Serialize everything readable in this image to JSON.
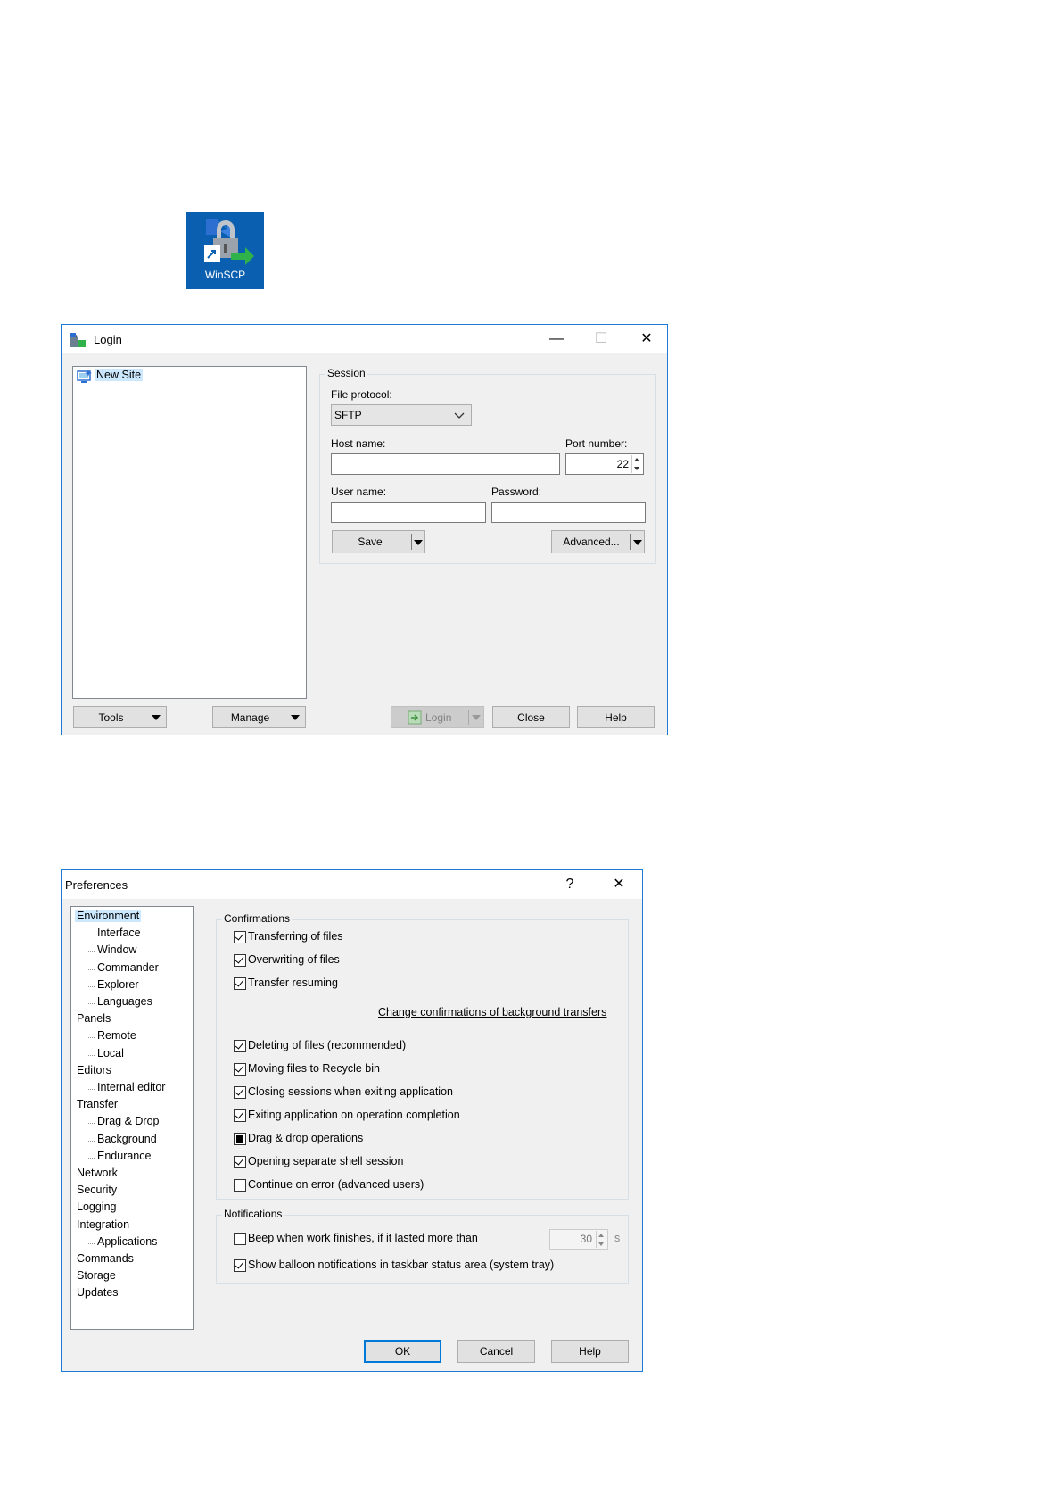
{
  "desktop_icon": {
    "label": "WinSCP"
  },
  "login": {
    "title": "Login",
    "window_controls": {
      "minimize": "—",
      "maximize": "☐",
      "close": "✕"
    },
    "tree_items": [
      "New Site"
    ],
    "session_group": "Session",
    "file_protocol_label": "File protocol:",
    "file_protocol_value": "SFTP",
    "host_name_label": "Host name:",
    "host_name_value": "",
    "port_number_label": "Port number:",
    "port_number_value": "22",
    "user_name_label": "User name:",
    "user_name_value": "",
    "password_label": "Password:",
    "password_value": "",
    "save_button": "Save",
    "advanced_button": "Advanced...",
    "tools_button": "Tools",
    "manage_button": "Manage",
    "login_button": "Login",
    "close_button": "Close",
    "help_button": "Help"
  },
  "preferences": {
    "title": "Preferences",
    "help_icon": "?",
    "close_icon": "✕",
    "tree": [
      {
        "label": "Environment",
        "level": 0,
        "selected": true
      },
      {
        "label": "Interface",
        "level": 1
      },
      {
        "label": "Window",
        "level": 1
      },
      {
        "label": "Commander",
        "level": 1
      },
      {
        "label": "Explorer",
        "level": 1
      },
      {
        "label": "Languages",
        "level": 1
      },
      {
        "label": "Panels",
        "level": 0
      },
      {
        "label": "Remote",
        "level": 1
      },
      {
        "label": "Local",
        "level": 1
      },
      {
        "label": "Editors",
        "level": 0
      },
      {
        "label": "Internal editor",
        "level": 1
      },
      {
        "label": "Transfer",
        "level": 0
      },
      {
        "label": "Drag & Drop",
        "level": 1
      },
      {
        "label": "Background",
        "level": 1
      },
      {
        "label": "Endurance",
        "level": 1
      },
      {
        "label": "Network",
        "level": 0
      },
      {
        "label": "Security",
        "level": 0
      },
      {
        "label": "Logging",
        "level": 0
      },
      {
        "label": "Integration",
        "level": 0
      },
      {
        "label": "Applications",
        "level": 1
      },
      {
        "label": "Commands",
        "level": 0
      },
      {
        "label": "Storage",
        "level": 0
      },
      {
        "label": "Updates",
        "level": 0
      }
    ],
    "confirmations_group": "Confirmations",
    "confirmations": [
      {
        "label": "Transferring of files",
        "state": "checked"
      },
      {
        "label": "Overwriting of files",
        "state": "checked"
      },
      {
        "label": "Transfer resuming",
        "state": "checked"
      },
      {
        "label": "Deleting of files (recommended)",
        "state": "checked"
      },
      {
        "label": "Moving files to Recycle bin",
        "state": "checked"
      },
      {
        "label": "Closing sessions when exiting application",
        "state": "checked"
      },
      {
        "label": "Exiting application on operation completion",
        "state": "checked"
      },
      {
        "label": "Drag & drop operations",
        "state": "indeterminate"
      },
      {
        "label": "Opening separate shell session",
        "state": "checked"
      },
      {
        "label": "Continue on error (advanced users)",
        "state": "unchecked"
      }
    ],
    "background_link": "Change confirmations of background transfers",
    "notifications_group": "Notifications",
    "beep_label": "Beep when work finishes, if it lasted more than",
    "beep_state": "unchecked",
    "beep_seconds": "30",
    "beep_unit": "s",
    "balloon_label": "Show balloon notifications in taskbar status area (system tray)",
    "balloon_state": "checked",
    "ok_button": "OK",
    "cancel_button": "Cancel",
    "help_button": "Help"
  }
}
